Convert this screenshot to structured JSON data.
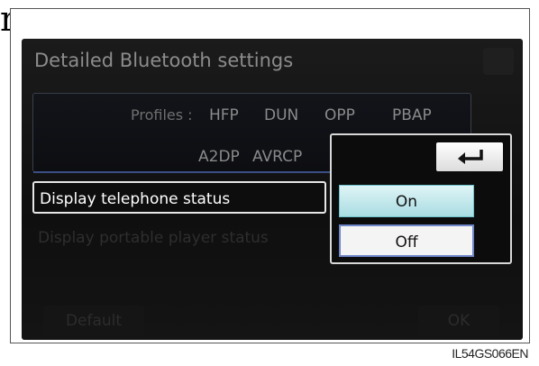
{
  "page_letter": "m",
  "figure_code": "IL54GS066EN",
  "screen": {
    "title": "Detailed Bluetooth settings",
    "profiles_label": "Profiles :",
    "profiles_row1": [
      "HFP",
      "DUN",
      "OPP",
      "PBAP"
    ],
    "profiles_row2": [
      "A2DP",
      "AVRCP"
    ],
    "rows": [
      {
        "label": "Display telephone status",
        "selected": true
      },
      {
        "label": "Display portable player status",
        "selected": false
      }
    ],
    "default_button": "Default",
    "ok_button": "OK"
  },
  "popup": {
    "back_icon": "return-arrow-icon",
    "options": [
      "On",
      "Off"
    ],
    "active_option": "On",
    "focused_option": "Off"
  },
  "colors": {
    "screen_bg": "#141414",
    "on_bg": "#a9dde2",
    "focus_border": "#6f86c9"
  }
}
